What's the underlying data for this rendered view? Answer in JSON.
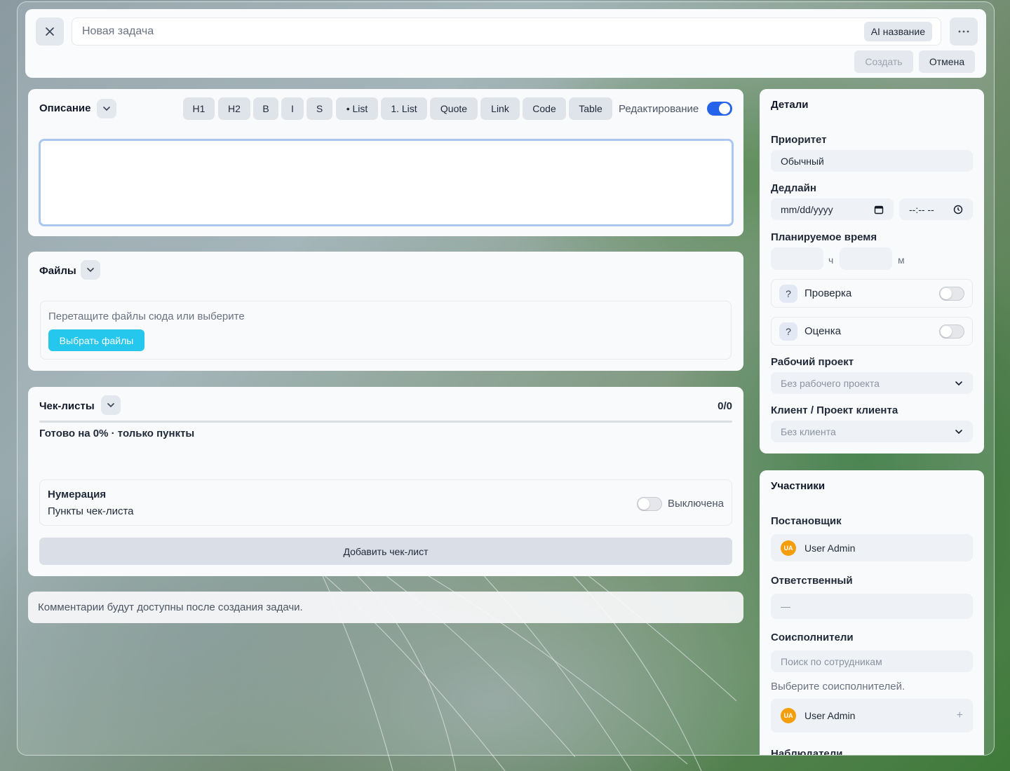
{
  "header": {
    "close_icon": "close-icon",
    "title_placeholder": "Новая задача",
    "ai_button": "AI название",
    "more_icon": "more-icon",
    "create_button": "Создать",
    "cancel_button": "Отмена"
  },
  "description": {
    "title": "Описание",
    "toolbar": [
      "H1",
      "H2",
      "B",
      "I",
      "S",
      "• List",
      "1. List",
      "Quote",
      "Link",
      "Code",
      "Table"
    ],
    "edit_mode_label": "Редактирование",
    "edit_mode_on": true,
    "text": ""
  },
  "files": {
    "title": "Файлы",
    "dropzone_text": "Перетащите файлы сюда или выберите",
    "choose_button": "Выбрать файлы"
  },
  "checklists": {
    "title": "Чек-листы",
    "count": "0/0",
    "progress": 0,
    "progress_text": "Готово на 0% · только пункты",
    "numbering_title": "Нумерация",
    "numbering_subtitle": "Пункты чек-листа",
    "numbering_state": "Выключена",
    "add_button": "Добавить чек-лист"
  },
  "comments_note": "Комментарии будут доступны после создания задачи.",
  "details": {
    "title": "Детали",
    "priority_label": "Приоритет",
    "priority_value": "Обычный",
    "deadline_label": "Дедлайн",
    "date_placeholder": "mm/dd/yyyy",
    "time_placeholder": "--:-- --",
    "planned_label": "Планируемое время",
    "hours_unit": "ч",
    "minutes_unit": "м",
    "review_label": "Проверка",
    "rating_label": "Оценка",
    "help_glyph": "?",
    "work_project_label": "Рабочий проект",
    "work_project_value": "Без рабочего проекта",
    "client_label": "Клиент / Проект клиента",
    "client_value": "Без клиента"
  },
  "participants": {
    "title": "Участники",
    "author_label": "Постановщик",
    "author_initials": "UA",
    "author_name": "User Admin",
    "responsible_label": "Ответственный",
    "responsible_value": "—",
    "coexecutors_label": "Соисполнители",
    "search_placeholder": "Поиск по сотрудникам",
    "hint": "Выберите соисполнителей.",
    "candidate_initials": "UA",
    "candidate_name": "User Admin",
    "add_glyph": "+",
    "observers_label": "Наблюдатели"
  }
}
